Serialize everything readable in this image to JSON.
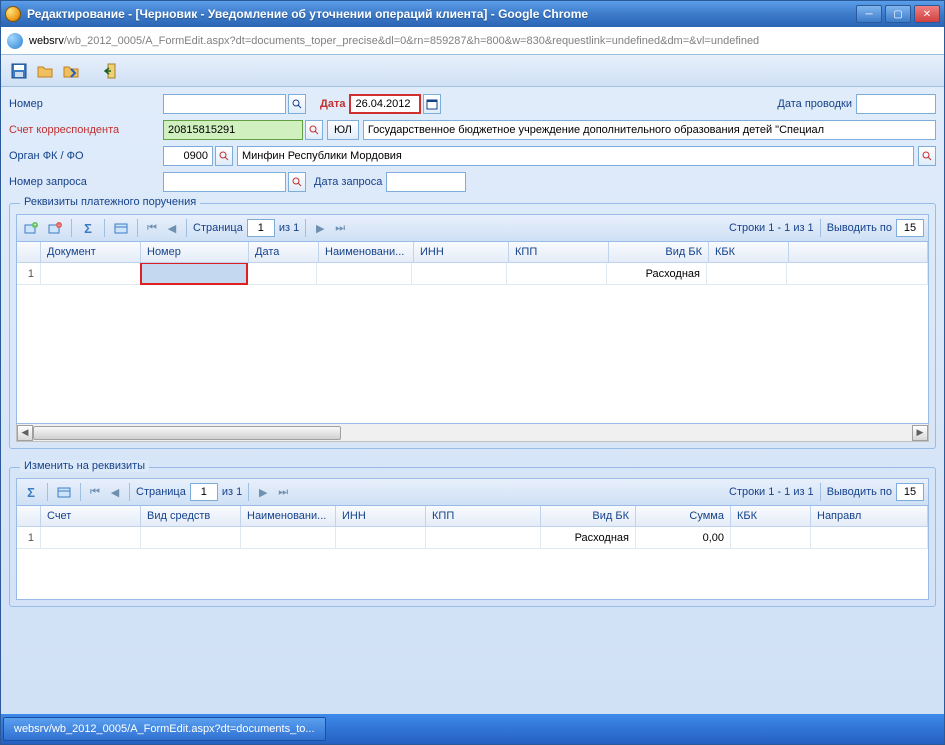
{
  "window": {
    "title": "Редактирование - [Черновик - Уведомление об уточнении операций клиента] - Google Chrome"
  },
  "url": {
    "host": "websrv",
    "path": "/wb_2012_0005/A_FormEdit.aspx?dt=documents_toper_precise&dl=0&rn=859287&h=800&w=830&requestlink=undefined&dm=&vl=undefined"
  },
  "form": {
    "number_label": "Номер",
    "number_value": "",
    "date_label": "Дата",
    "date_value": "26.04.2012",
    "posting_date_label": "Дата проводки",
    "posting_date_value": "",
    "corr_account_label": "Счет корреспондента",
    "corr_account_value": "20815815291",
    "legal_btn": "ЮЛ",
    "corr_name": "Государственное бюджетное учреждение дополнительного образования детей \"Специал",
    "organ_label": "Орган ФК / ФО",
    "organ_code": "0900",
    "organ_name": "Минфин Республики Мордовия",
    "request_num_label": "Номер запроса",
    "request_num_value": "",
    "request_date_label": "Дата запроса",
    "request_date_value": ""
  },
  "fieldset1": {
    "legend": "Реквизиты платежного поручения",
    "page_label": "Страница",
    "page_value": "1",
    "page_of": "из 1",
    "rows_info": "Строки 1 - 1 из 1",
    "per_page_label": "Выводить по",
    "per_page_value": "15",
    "columns": [
      "",
      "Документ",
      "Номер",
      "Дата",
      "Наименовани...",
      "ИНН",
      "КПП",
      "Вид БК",
      "КБК"
    ],
    "row1": {
      "num": "1",
      "vid_bk": "Расходная"
    }
  },
  "fieldset2": {
    "legend": "Изменить на реквизиты",
    "page_label": "Страница",
    "page_value": "1",
    "page_of": "из 1",
    "rows_info": "Строки 1 - 1 из 1",
    "per_page_label": "Выводить по",
    "per_page_value": "15",
    "columns": [
      "",
      "Счет",
      "Вид средств",
      "Наименовани...",
      "ИНН",
      "КПП",
      "Вид БК",
      "Сумма",
      "КБК",
      "Направл"
    ],
    "row1": {
      "num": "1",
      "vid_bk": "Расходная",
      "summa": "0,00"
    }
  },
  "taskbar": {
    "item": "websrv/wb_2012_0005/A_FormEdit.aspx?dt=documents_to..."
  }
}
